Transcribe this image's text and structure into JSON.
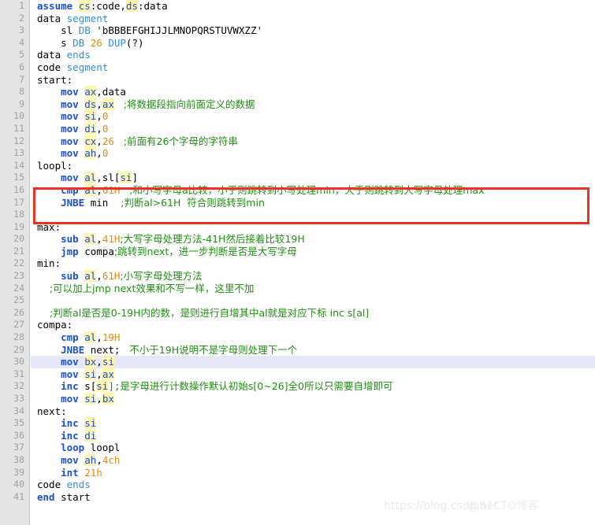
{
  "editor": {
    "language": "x86 Assembly (MASM)",
    "current_line": 30,
    "total_lines": 41,
    "gutter_bg": "#e4e4e4",
    "line_number_color": "#a0a0a0",
    "highlight_color": "#e7e7fa",
    "annotation_box_color": "#ee2f24"
  },
  "watermark": {
    "url": "https://blog.csdn.net",
    "handle": "@51CTO博客"
  },
  "annotation": {
    "box_lines": [
      16,
      17
    ]
  },
  "lines": [
    {
      "n": "1",
      "text": "assume cs:code,ds:data"
    },
    {
      "n": "2",
      "text": "data segment"
    },
    {
      "n": "3",
      "text": "    sl DB 'bBBBEFGHIJJLMNOPQRSTUVWXZZ'"
    },
    {
      "n": "4",
      "text": "    s DB 26 DUP(?)"
    },
    {
      "n": "5",
      "text": "data ends"
    },
    {
      "n": "6",
      "text": "code segment"
    },
    {
      "n": "7",
      "text": "start:"
    },
    {
      "n": "8",
      "text": "    mov ax,data"
    },
    {
      "n": "9",
      "text": "    mov ds,ax   ;将数据段指向前面定义的数据"
    },
    {
      "n": "10",
      "text": "    mov si,0"
    },
    {
      "n": "11",
      "text": "    mov di,0"
    },
    {
      "n": "12",
      "text": "    mov cx,26   ;前面有26个字母的字符串"
    },
    {
      "n": "13",
      "text": "    mov ah,0"
    },
    {
      "n": "14",
      "text": "loopl:"
    },
    {
      "n": "15",
      "text": "    mov al,sl[si]"
    },
    {
      "n": "16",
      "text": "    cmp al,61H   ;和小写字母a比较，小于则跳转到小写处理min，大于则跳转到大写字母处理max"
    },
    {
      "n": "17",
      "text": "    JNBE min    ;判断al>61H  符合则跳转到min"
    },
    {
      "n": "18",
      "text": ""
    },
    {
      "n": "19",
      "text": "max:"
    },
    {
      "n": "20",
      "text": "    sub al,41H;大写字母处理方法-41H然后接着比较19H"
    },
    {
      "n": "21",
      "text": "    jmp compa;跳转到next，进一步判断是否是大写字母"
    },
    {
      "n": "22",
      "text": "min:"
    },
    {
      "n": "23",
      "text": "    sub al,61H;小写字母处理方法"
    },
    {
      "n": "24",
      "text": "    ;可以加上jmp next效果和不写一样，这里不加"
    },
    {
      "n": "25",
      "text": ""
    },
    {
      "n": "26",
      "text": "    ;判断al是否是0-19H内的数，是则进行自增其中al就是对应下标 inc s[al]"
    },
    {
      "n": "27",
      "text": "compa:"
    },
    {
      "n": "28",
      "text": "    cmp al,19H"
    },
    {
      "n": "29",
      "text": "    JNBE next;   不小于19H说明不是字母则处理下一个"
    },
    {
      "n": "30",
      "text": "    mov bx,si"
    },
    {
      "n": "31",
      "text": "    mov si,ax"
    },
    {
      "n": "32",
      "text": "    inc s[si];是字母进行计数操作默认初始s[0~26]全0所以只需要自增即可"
    },
    {
      "n": "33",
      "text": "    mov si,bx"
    },
    {
      "n": "34",
      "text": "next:"
    },
    {
      "n": "35",
      "text": "    inc si"
    },
    {
      "n": "36",
      "text": "    inc di"
    },
    {
      "n": "37",
      "text": "    loop loopl"
    },
    {
      "n": "38",
      "text": "    mov ah,4ch"
    },
    {
      "n": "39",
      "text": "    int 21h"
    },
    {
      "n": "40",
      "text": "code ends"
    },
    {
      "n": "41",
      "text": "end start"
    }
  ],
  "tokens": {
    "l1": {
      "kw": "assume",
      "r1": "cs",
      "t1": ":code,",
      "r2": "ds",
      "t2": ":data"
    },
    "l2": {
      "a": "data ",
      "b": "segment"
    },
    "l3": {
      "a": "    sl ",
      "b": "DB",
      "c": " 'bBBBEFGHIJJLMNOPQRSTUVWXZZ'"
    },
    "l4": {
      "a": "    s ",
      "b": "DB",
      "c": " ",
      "d": "26",
      "e": " ",
      "f": "DUP",
      "g": "(?)"
    },
    "l5": {
      "a": "data ",
      "b": "ends"
    },
    "l6": {
      "a": "code ",
      "b": "segment"
    },
    "l7": {
      "a": "start:"
    },
    "l8": {
      "kw": "mov",
      "r": "ax",
      "t": ",data"
    },
    "l9": {
      "kw": "mov",
      "r1": "ds",
      "t1": ",",
      "r2": "ax",
      "cmt": "   ;将数据段指向前面定义的数据"
    },
    "l10": {
      "kw": "mov",
      "r": "si",
      "t": ",",
      "n": "0"
    },
    "l11": {
      "kw": "mov",
      "r": "di",
      "t": ",",
      "n": "0"
    },
    "l12": {
      "kw": "mov",
      "r": "cx",
      "t": ",",
      "n": "26",
      "cmt": "   ;前面有26个字母的字符串"
    },
    "l13": {
      "kw": "mov",
      "r": "ah",
      "t": ",",
      "n": "0"
    },
    "l14": {
      "a": "loopl:"
    },
    "l15": {
      "kw": "mov",
      "r1": "al",
      "t1": ",sl[",
      "r2": "si",
      "t2": "]"
    },
    "l16": {
      "kw": "cmp",
      "r": "al",
      "t": ",",
      "n": "61H",
      "cmt": "   ;和小写字母a比较，小于则跳转到小写处理min，大于则跳转到大写字母处理max"
    },
    "l17": {
      "kw": "JNBE",
      "t": " min",
      "cmt": "    ;判断al>61H  符合则跳转到min"
    },
    "l19": {
      "a": "max:"
    },
    "l20": {
      "kw": "sub",
      "r": "al",
      "t": ",",
      "n": "41H",
      "cmt": ";大写字母处理方法-41H然后接着比较19H"
    },
    "l21": {
      "kw": "jmp",
      "t": " compa",
      "cmt": ";跳转到next，进一步判断是否是大写字母"
    },
    "l22": {
      "a": "min:"
    },
    "l23": {
      "kw": "sub",
      "r": "al",
      "t": ",",
      "n": "61H",
      "cmt": ";小写字母处理方法"
    },
    "l24": {
      "cmt": "    ;可以加上jmp next效果和不写一样，这里不加"
    },
    "l26": {
      "cmt": "    ;判断al是否是0-19H内的数，是则进行自增其中al就是对应下标 inc s[al]"
    },
    "l27": {
      "a": "compa:"
    },
    "l28": {
      "kw": "cmp",
      "r": "al",
      "t": ",",
      "n": "19H"
    },
    "l29": {
      "kw": "JNBE",
      "t": " next;",
      "cmt": "   不小于19H说明不是字母则处理下一个"
    },
    "l30": {
      "kw": "mov",
      "r1": "bx",
      "t": ",",
      "r2": "si"
    },
    "l31": {
      "kw": "mov",
      "r1": "si",
      "t": ",",
      "r2": "ax"
    },
    "l32": {
      "kw": "inc",
      "t1": " s[",
      "r": "si",
      "t2": "];",
      "cmt": "是字母进行计数操作默认初始s[0~26]全0所以只需要自增即可"
    },
    "l33": {
      "kw": "mov",
      "r1": "si",
      "t": ",",
      "r2": "bx"
    },
    "l34": {
      "a": "next:"
    },
    "l35": {
      "kw": "inc",
      "r": "si"
    },
    "l36": {
      "kw": "inc",
      "r": "di"
    },
    "l37": {
      "kw": "loop",
      "t": " loopl"
    },
    "l38": {
      "kw": "mov",
      "r": "ah",
      "t": ",",
      "n": "4ch"
    },
    "l39": {
      "kw": "int",
      "t": " ",
      "n": "21h"
    },
    "l40": {
      "a": "code ",
      "b": "ends"
    },
    "l41": {
      "kw": "end",
      "t": " start"
    }
  }
}
